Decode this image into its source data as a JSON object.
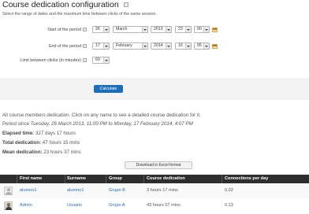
{
  "header": {
    "title": "Course dedication configuration",
    "help_icon": "help-icon"
  },
  "form": {
    "intro": "Select the range of dates and the maximum time between clicks of the same session.",
    "start": {
      "label": "Start of the period",
      "day": "26",
      "month": "March",
      "year": "2013",
      "hour": "23",
      "minute": "00"
    },
    "end": {
      "label": "End of the period",
      "day": "17",
      "month": "February",
      "year": "2014",
      "hour": "16",
      "minute": "05"
    },
    "limit": {
      "label": "Limit between clicks (in minutes)",
      "value": "60"
    },
    "calculate_label": "Calculate"
  },
  "results": {
    "intro": "All course members dedication. Click on any name to see a detailed course dedication for it.",
    "period_prefix": "Period since",
    "period_start": "Tuesday, 26 March 2013, 11:00 PM",
    "period_to": "to",
    "period_end": "Monday, 17 February 2014, 4:07 PM",
    "elapsed_label": "Elapsed time:",
    "elapsed_value": "327 days 17 hours",
    "total_label": "Total dedication:",
    "total_value": "47 hours 15 mins",
    "mean_label": "Mean dedication:",
    "mean_value": "23 hours 37 mins",
    "download_label": "Download in Excel format"
  },
  "table": {
    "headers": [
      "",
      "First name",
      "Surname",
      "Group",
      "Course dedication",
      "Connections per day"
    ],
    "rows": [
      {
        "first": "alumno1",
        "surname": "alumno1",
        "group": "Grupo B",
        "dedication": "3 hours 17 mins",
        "connections": "0.02"
      },
      {
        "first": "Admin",
        "surname": "Usuario",
        "group": "Grupo A",
        "dedication": "43 hours 57 mins",
        "connections": "0.13"
      }
    ]
  }
}
